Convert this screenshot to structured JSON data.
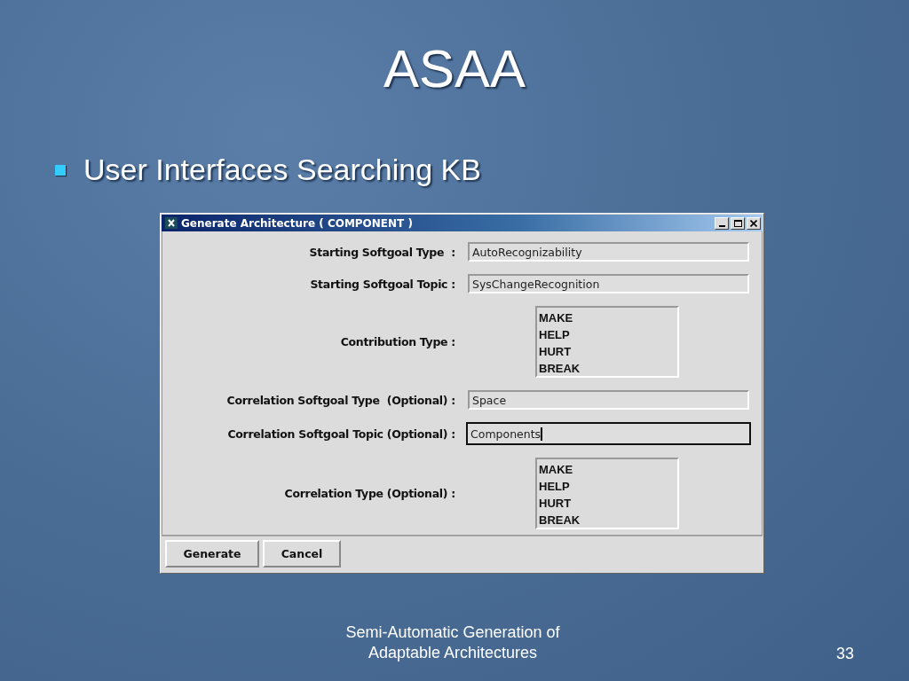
{
  "slide": {
    "title": "ASAA",
    "bullets": [
      {
        "text": "User Interfaces Searching KB"
      }
    ],
    "footer": "Semi-Automatic Generation of Adaptable Architectures",
    "page_number": "33"
  },
  "window": {
    "title": "Generate Architecture ( COMPONENT )",
    "fields": [
      {
        "kind": "text",
        "label": "Starting Softgoal Type  :",
        "value": "AutoRecognizability",
        "focused": false
      },
      {
        "kind": "text",
        "label": "Starting Softgoal Topic :",
        "value": "SysChangeRecognition",
        "focused": false
      },
      {
        "kind": "list",
        "label": "Contribution Type :",
        "options": [
          "MAKE",
          "HELP",
          "HURT",
          "BREAK"
        ]
      },
      {
        "kind": "text",
        "label": "Correlation Softgoal Type  (Optional) :",
        "value": "Space",
        "focused": false
      },
      {
        "kind": "text",
        "label": "Correlation Softgoal Topic (Optional) :",
        "value": "Components",
        "focused": true
      },
      {
        "kind": "list",
        "label": "Correlation Type (Optional) :",
        "options": [
          "MAKE",
          "HELP",
          "HURT",
          "BREAK"
        ]
      }
    ],
    "buttons": [
      "Generate",
      "Cancel"
    ]
  }
}
